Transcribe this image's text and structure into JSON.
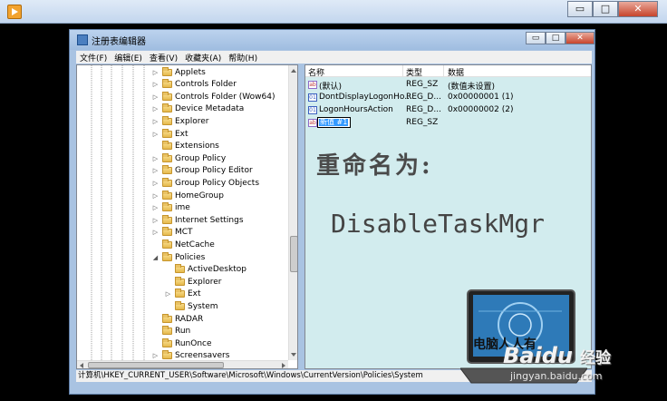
{
  "outer_window": {
    "buttons": {
      "minimize": "▭",
      "maximize": "□",
      "close": "✕"
    }
  },
  "regedit": {
    "title": "注册表编辑器",
    "buttons": {
      "minimize": "▭",
      "maximize": "□",
      "close": "✕"
    },
    "menu": [
      "文件(F)",
      "编辑(E)",
      "查看(V)",
      "收藏夹(A)",
      "帮助(H)"
    ],
    "tree": [
      {
        "label": "Applets",
        "expand": "▷",
        "level": 0
      },
      {
        "label": "Controls Folder",
        "expand": "▷",
        "level": 0
      },
      {
        "label": "Controls Folder (Wow64)",
        "expand": "▷",
        "level": 0
      },
      {
        "label": "Device Metadata",
        "expand": "▷",
        "level": 0
      },
      {
        "label": "Explorer",
        "expand": "▷",
        "level": 0
      },
      {
        "label": "Ext",
        "expand": "▷",
        "level": 0
      },
      {
        "label": "Extensions",
        "expand": "",
        "level": 0
      },
      {
        "label": "Group Policy",
        "expand": "▷",
        "level": 0
      },
      {
        "label": "Group Policy Editor",
        "expand": "▷",
        "level": 0
      },
      {
        "label": "Group Policy Objects",
        "expand": "▷",
        "level": 0
      },
      {
        "label": "HomeGroup",
        "expand": "▷",
        "level": 0
      },
      {
        "label": "ime",
        "expand": "▷",
        "level": 0
      },
      {
        "label": "Internet Settings",
        "expand": "▷",
        "level": 0
      },
      {
        "label": "MCT",
        "expand": "▷",
        "level": 0
      },
      {
        "label": "NetCache",
        "expand": "",
        "level": 0
      },
      {
        "label": "Policies",
        "expand": "◢",
        "level": 0
      },
      {
        "label": "ActiveDesktop",
        "expand": "",
        "level": 1
      },
      {
        "label": "Explorer",
        "expand": "",
        "level": 1
      },
      {
        "label": "Ext",
        "expand": "▷",
        "level": 1
      },
      {
        "label": "System",
        "expand": "",
        "level": 1
      },
      {
        "label": "RADAR",
        "expand": "",
        "level": 0
      },
      {
        "label": "Run",
        "expand": "",
        "level": 0
      },
      {
        "label": "RunOnce",
        "expand": "",
        "level": 0
      },
      {
        "label": "Screensavers",
        "expand": "▷",
        "level": 0
      }
    ],
    "columns": {
      "name": "名称",
      "type": "类型",
      "data": "数据"
    },
    "values": [
      {
        "icon": "ab",
        "name": "(默认)",
        "type": "REG_SZ",
        "data": "(数值未设置)"
      },
      {
        "icon": "01",
        "name": "DontDisplayLogonHo...",
        "type": "REG_D...",
        "data": "0x00000001 (1)"
      },
      {
        "icon": "01",
        "name": "LogonHoursAction",
        "type": "REG_D...",
        "data": "0x00000002 (2)"
      },
      {
        "icon": "ab",
        "name": "新值 #1",
        "type": "REG_SZ",
        "data": ""
      }
    ],
    "overlay_text_1": "重命名为:",
    "overlay_text_2": "DisableTaskMgr",
    "status": "计算机\\HKEY_CURRENT_USER\\Software\\Microsoft\\Windows\\CurrentVersion\\Policies\\System"
  },
  "watermark": {
    "logo_text": "电脑人人有",
    "baidu_text": "Baidu",
    "jingyan_text": "经验",
    "url": "jingyan.baidu.com"
  }
}
